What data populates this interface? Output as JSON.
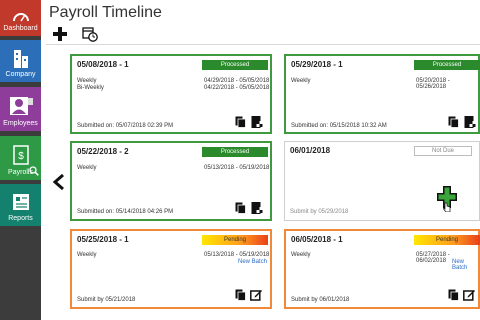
{
  "sidebar": {
    "items": [
      {
        "label": "Dashboard",
        "icon": "speedometer-icon"
      },
      {
        "label": "Company",
        "icon": "building-icon"
      },
      {
        "label": "Employees",
        "icon": "employee-badge-icon"
      },
      {
        "label": "Payrolls",
        "icon": "payroll-document-icon"
      },
      {
        "label": "Reports",
        "icon": "report-icon"
      }
    ]
  },
  "header": {
    "title": "Payroll Timeline"
  },
  "toolbar": {
    "add_icon": "plus-icon",
    "history_icon": "calendar-clock-icon"
  },
  "cards": [
    {
      "date": "05/08/2018 - 1",
      "status": "Processed",
      "rows": [
        {
          "label": "Weekly",
          "range": "04/29/2018 - 05/05/2018"
        },
        {
          "label": "Bi-Weekly",
          "range": "04/22/2018 - 05/05/2018"
        }
      ],
      "footer": "Submitted on: 05/07/2018 02:39 PM"
    },
    {
      "date": "05/29/2018 - 1",
      "status": "Processed",
      "rows": [
        {
          "label": "Weekly",
          "range": "05/20/2018 - 05/26/2018"
        }
      ],
      "footer": "Submitted on: 05/15/2018 10:32 AM"
    },
    {
      "date": "05/22/2018 - 2",
      "status": "Processed",
      "rows": [
        {
          "label": "Weekly",
          "range": "05/13/2018 - 05/19/2018"
        }
      ],
      "footer": "Submitted on: 05/14/2018 04:26 PM"
    },
    {
      "date": "06/01/2018",
      "status": "Not Due",
      "rows": [],
      "footer": "Submit by 05/29/2018"
    },
    {
      "date": "05/25/2018 - 1",
      "status": "Pending",
      "rows": [
        {
          "label": "Weekly",
          "range": "05/13/2018 - 05/19/2018"
        }
      ],
      "link": "New Batch",
      "footer": "Submit by 05/21/2018"
    },
    {
      "date": "06/05/2018 - 1",
      "status": "Pending",
      "rows": [
        {
          "label": "Weekly",
          "range": "05/27/2018 - 06/02/2018"
        }
      ],
      "link": "New Batch",
      "footer": "Submit by 06/01/2018"
    }
  ],
  "colors": {
    "processed": "#3f9a3f",
    "pending": "#f08a3a",
    "link": "#2b6cc4"
  }
}
